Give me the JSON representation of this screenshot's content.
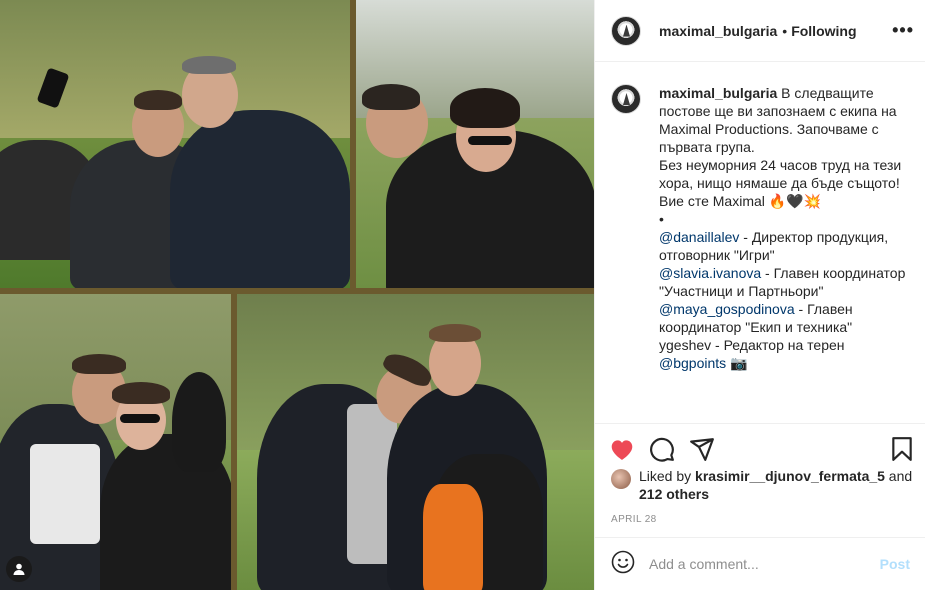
{
  "post": {
    "username": "maximal_bulgaria",
    "separator": "•",
    "follow_status": "Following",
    "more_label": "•••"
  },
  "caption": {
    "username": "maximal_bulgaria",
    "lines": [
      "В следващите постове ще ви запознаем с екипа на Maximal Productions. Започваме с първата група.",
      "Без неуморния 24 часов труд на тези хора, нищо нямаше да бъде същото!",
      "Вие сте Maximal 🔥🖤💥",
      "•"
    ],
    "credits": [
      {
        "mention": "@danaillalev",
        "text": " - Директор продукция, отговорник \"Игри\""
      },
      {
        "mention": "@slavia.ivanova",
        "text": " - Главен координатор \"Участници и Партньори\""
      },
      {
        "mention": "@maya_gospodinova",
        "text": " - Главен координатор \"Екип и техника\""
      },
      {
        "mention": "",
        "text": "ygeshev - Редактор на терен"
      },
      {
        "mention": "@bgpoints",
        "text": " 📷"
      }
    ]
  },
  "likes": {
    "prefix": "Liked by ",
    "user": "krasimir__djunov_fermata_5",
    "middle": " and",
    "others": "212 others"
  },
  "date": "APRIL 28",
  "comment": {
    "placeholder": "Add a comment...",
    "post_label": "Post"
  },
  "colors": {
    "like_red": "#ed4956",
    "mention_blue": "#00376b",
    "post_disabled": "#b2dffc",
    "frame_gold": "#6b5a2e"
  },
  "icons": {
    "like": "heart-icon",
    "comment": "comment-bubble-icon",
    "share": "paper-plane-icon",
    "save": "bookmark-icon",
    "emoji": "smiley-icon",
    "tag": "user-tag-icon"
  }
}
